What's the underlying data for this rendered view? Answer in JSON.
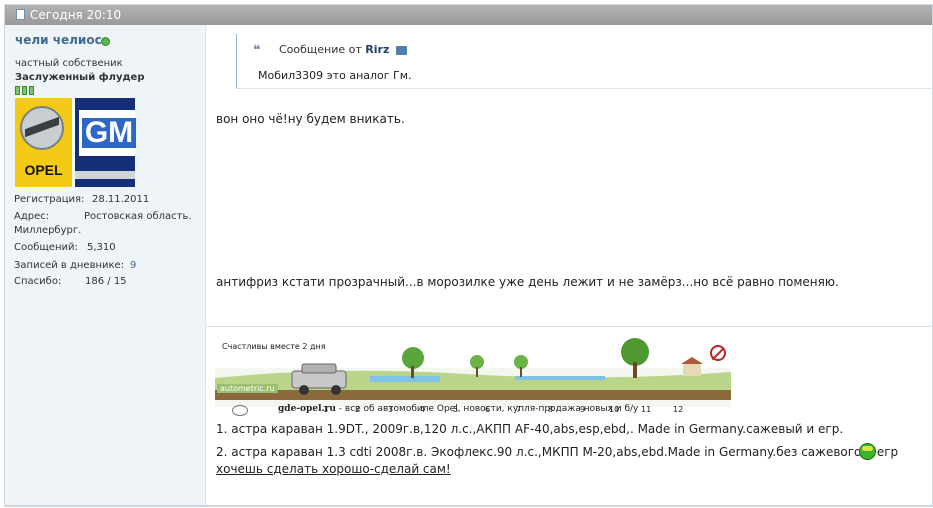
{
  "post": {
    "date": "Сегодня 20:10"
  },
  "user": {
    "name": "чели челиос",
    "title": "частный собственик",
    "rank": "Заслуженный флудер",
    "avatar": {
      "left_logo_text": "OPEL",
      "right_logo_text": "GM"
    },
    "stats": {
      "registration": {
        "label": "Регистрация:",
        "value": "28.11.2011"
      },
      "address": {
        "label": "Адрес:",
        "value": "Ростовская область.",
        "value2": "Миллербург."
      },
      "posts": {
        "label": "Сообщений:",
        "value": "5,310"
      },
      "diary": {
        "label": "Записей в дневнике:",
        "value": "9"
      },
      "thanks": {
        "label": "Спасибо:",
        "value": "186 / 15"
      }
    }
  },
  "quote": {
    "header_prefix": "Сообщение от",
    "author": "Rirz",
    "text": "Мобил3309 это аналог Гм."
  },
  "message": {
    "line1": "вон оно чё!ну будем вникать.",
    "line2": "антифриз кстати прозрачный...в морозилке уже день лежит и не замёрз...но всё равно поменяю."
  },
  "signature": {
    "banner": {
      "caption": "Счастливы вместе 2 дня",
      "brand": "autometric.ru",
      "numbers": [
        "1",
        "2",
        "3",
        "4",
        "5",
        "6",
        "7",
        "8",
        "9",
        "10",
        "11",
        "12"
      ]
    },
    "opel_site": "gde-opel.ru",
    "opel_desc": " - все об автомобиле Opel, новости, купля-продажа новых и б/у",
    "car1": "1. астра караван 1.9DT., 2009г.в,120 л.с.,АКПП AF-40,abs,esp,ebd,. Made in Germany.сажевый и егр.",
    "car2": "2. астра караван 1.3 cdti 2008г.в. Экофлекс.90 л.с.,МКПП М-20,abs,ebd.Made in Germany.без сажевого и егр",
    "motto": "хочешь сделать хорошо-сделай сам!"
  }
}
